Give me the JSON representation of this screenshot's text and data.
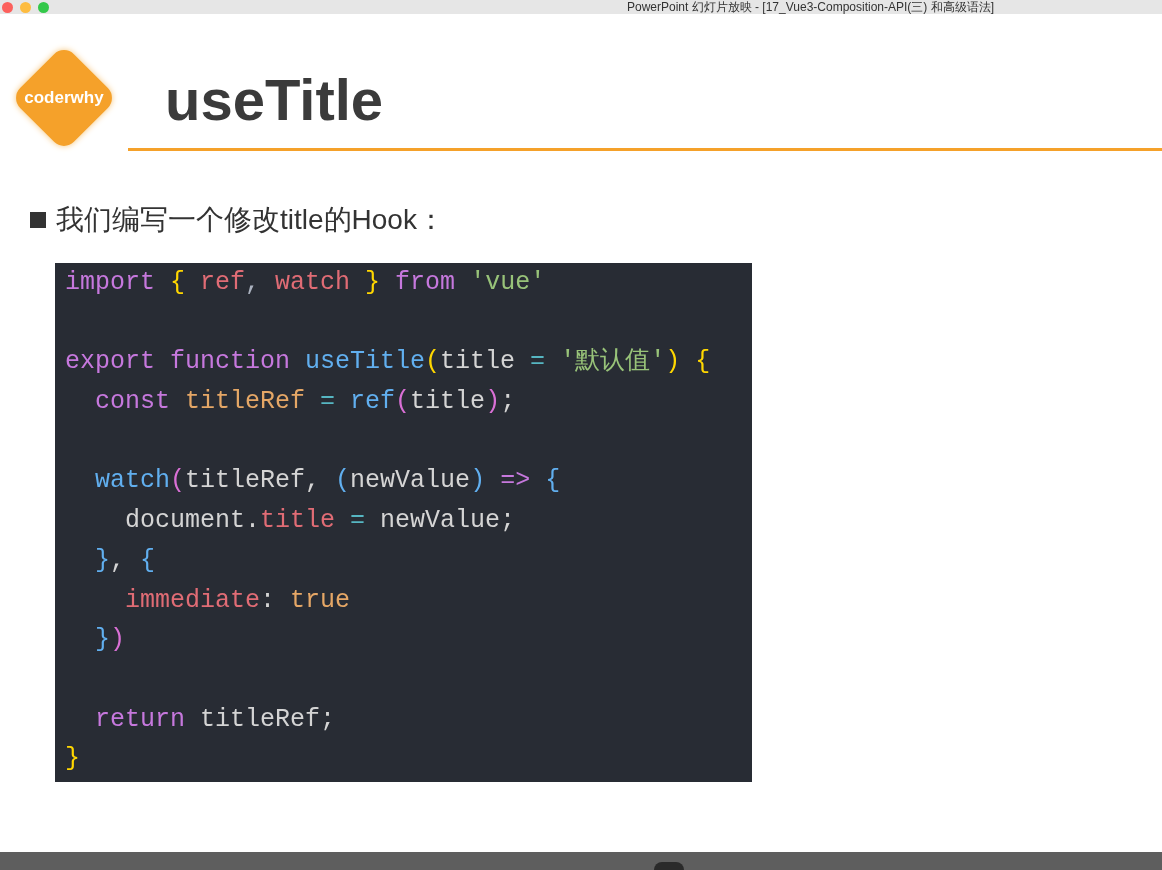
{
  "window": {
    "title": "PowerPoint 幻灯片放映 - [17_Vue3-Composition-API(三) 和高级语法]"
  },
  "slide": {
    "logo": "coderwhy",
    "title": "useTitle",
    "bullet": "我们编写一个修改title的Hook：",
    "code": [
      {
        "kind": "code",
        "tokens": [
          {
            "text": "import ",
            "color": "#c678dd"
          },
          {
            "text": "{ ",
            "color": "#ffd700"
          },
          {
            "text": "ref",
            "color": "#e06c75"
          },
          {
            "text": ", ",
            "color": "#abb2bf"
          },
          {
            "text": "watch ",
            "color": "#e06c75"
          },
          {
            "text": "} ",
            "color": "#ffd700"
          },
          {
            "text": "from ",
            "color": "#c678dd"
          },
          {
            "text": "'vue'",
            "color": "#98c379"
          }
        ]
      },
      {
        "kind": "blank"
      },
      {
        "kind": "code",
        "tokens": [
          {
            "text": "export function ",
            "color": "#c678dd"
          },
          {
            "text": "useTitle",
            "color": "#61afef"
          },
          {
            "text": "(",
            "color": "#ffd700"
          },
          {
            "text": "title ",
            "color": "#d4d4d4"
          },
          {
            "text": "= ",
            "color": "#56b6c2"
          },
          {
            "text": "'默认值'",
            "color": "#98c379"
          },
          {
            "text": ") {",
            "color": "#ffd700"
          }
        ]
      },
      {
        "kind": "code",
        "tokens": [
          {
            "text": "  const ",
            "color": "#c678dd"
          },
          {
            "text": "titleRef ",
            "color": "#e5a766"
          },
          {
            "text": "= ",
            "color": "#56b6c2"
          },
          {
            "text": "ref",
            "color": "#61afef"
          },
          {
            "text": "(",
            "color": "#da70d6"
          },
          {
            "text": "title",
            "color": "#d4d4d4"
          },
          {
            "text": ")",
            "color": "#da70d6"
          },
          {
            "text": ";",
            "color": "#d4d4d4"
          }
        ]
      },
      {
        "kind": "blank"
      },
      {
        "kind": "code",
        "tokens": [
          {
            "text": "  watch",
            "color": "#61afef"
          },
          {
            "text": "(",
            "color": "#da70d6"
          },
          {
            "text": "titleRef, ",
            "color": "#d4d4d4"
          },
          {
            "text": "(",
            "color": "#61afef"
          },
          {
            "text": "newValue",
            "color": "#d4d4d4"
          },
          {
            "text": ") ",
            "color": "#61afef"
          },
          {
            "text": "=> ",
            "color": "#c678dd"
          },
          {
            "text": "{",
            "color": "#61afef"
          }
        ]
      },
      {
        "kind": "code",
        "tokens": [
          {
            "text": "    document.",
            "color": "#d4d4d4"
          },
          {
            "text": "title ",
            "color": "#e06c75"
          },
          {
            "text": "= ",
            "color": "#56b6c2"
          },
          {
            "text": "newValue;",
            "color": "#d4d4d4"
          }
        ]
      },
      {
        "kind": "code",
        "tokens": [
          {
            "text": "  }",
            "color": "#61afef"
          },
          {
            "text": ", ",
            "color": "#d4d4d4"
          },
          {
            "text": "{",
            "color": "#61afef"
          }
        ]
      },
      {
        "kind": "code",
        "tokens": [
          {
            "text": "    immediate",
            "color": "#e06c75"
          },
          {
            "text": ": ",
            "color": "#d4d4d4"
          },
          {
            "text": "true",
            "color": "#e5a766"
          }
        ]
      },
      {
        "kind": "code",
        "tokens": [
          {
            "text": "  }",
            "color": "#61afef"
          },
          {
            "text": ")",
            "color": "#da70d6"
          }
        ]
      },
      {
        "kind": "blank"
      },
      {
        "kind": "code",
        "tokens": [
          {
            "text": "  return ",
            "color": "#c678dd"
          },
          {
            "text": "titleRef;",
            "color": "#d4d4d4"
          }
        ]
      },
      {
        "kind": "code",
        "tokens": [
          {
            "text": "}",
            "color": "#ffd700"
          }
        ]
      }
    ]
  }
}
